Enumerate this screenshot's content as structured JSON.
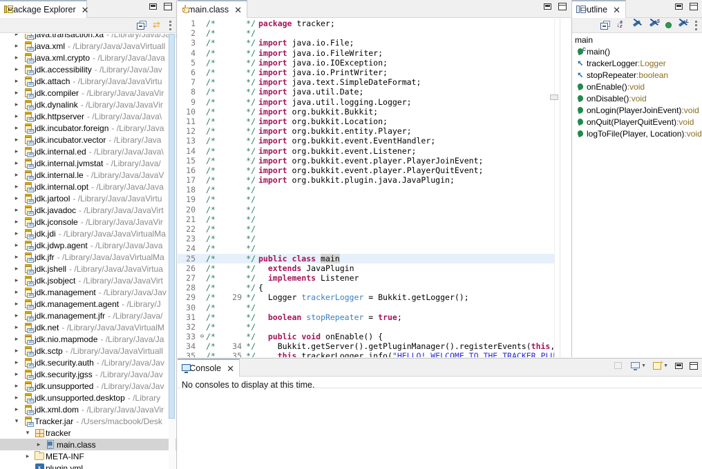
{
  "package_explorer": {
    "tab_label": "Package Explorer",
    "close_label": "✕",
    "toolbar": [
      "collapse-all-icon",
      "link-with-editor-icon",
      "view-menu-icon"
    ],
    "items": [
      {
        "name": "java.transaction.xa",
        "path": "- /Library/Java/JavaVi",
        "indent": 1,
        "arrow": "closed",
        "icon": "jar",
        "clipped": true
      },
      {
        "name": "java.xml",
        "path": "- /Library/Java/JavaVirtuall",
        "indent": 1,
        "arrow": "closed",
        "icon": "jar"
      },
      {
        "name": "java.xml.crypto",
        "path": "- /Library/Java/Java",
        "indent": 1,
        "arrow": "closed",
        "icon": "jar"
      },
      {
        "name": "jdk.accessibility",
        "path": "- /Library/Java/Jav",
        "indent": 1,
        "arrow": "closed",
        "icon": "jar"
      },
      {
        "name": "jdk.attach",
        "path": "- /Library/Java/JavaVirtu",
        "indent": 1,
        "arrow": "closed",
        "icon": "jar"
      },
      {
        "name": "jdk.compiler",
        "path": "- /Library/Java/JavaVir",
        "indent": 1,
        "arrow": "closed",
        "icon": "jar"
      },
      {
        "name": "jdk.dynalink",
        "path": "- /Library/Java/JavaVir",
        "indent": 1,
        "arrow": "closed",
        "icon": "jar"
      },
      {
        "name": "jdk.httpserver",
        "path": "- /Library/Java/Java\\",
        "indent": 1,
        "arrow": "closed",
        "icon": "jar"
      },
      {
        "name": "jdk.incubator.foreign",
        "path": "- /Library/Java",
        "indent": 1,
        "arrow": "closed",
        "icon": "jar"
      },
      {
        "name": "jdk.incubator.vector",
        "path": "- /Library/Java",
        "indent": 1,
        "arrow": "closed",
        "icon": "jar"
      },
      {
        "name": "jdk.internal.ed",
        "path": "- /Library/Java/Java\\",
        "indent": 1,
        "arrow": "closed",
        "icon": "jar"
      },
      {
        "name": "jdk.internal.jvmstat",
        "path": "- /Library/Java/",
        "indent": 1,
        "arrow": "closed",
        "icon": "jar"
      },
      {
        "name": "jdk.internal.le",
        "path": "- /Library/Java/JavaV",
        "indent": 1,
        "arrow": "closed",
        "icon": "jar"
      },
      {
        "name": "jdk.internal.opt",
        "path": "- /Library/Java/Java",
        "indent": 1,
        "arrow": "closed",
        "icon": "jar"
      },
      {
        "name": "jdk.jartool",
        "path": "- /Library/Java/JavaVirtu",
        "indent": 1,
        "arrow": "closed",
        "icon": "jar"
      },
      {
        "name": "jdk.javadoc",
        "path": "- /Library/Java/JavaVirt",
        "indent": 1,
        "arrow": "closed",
        "icon": "jar"
      },
      {
        "name": "jdk.jconsole",
        "path": "- /Library/Java/JavaVir",
        "indent": 1,
        "arrow": "closed",
        "icon": "jar"
      },
      {
        "name": "jdk.jdi",
        "path": "- /Library/Java/JavaVirtualMa",
        "indent": 1,
        "arrow": "closed",
        "icon": "jar"
      },
      {
        "name": "jdk.jdwp.agent",
        "path": "- /Library/Java/Java",
        "indent": 1,
        "arrow": "closed",
        "icon": "jar"
      },
      {
        "name": "jdk.jfr",
        "path": "- /Library/Java/JavaVirtualMa",
        "indent": 1,
        "arrow": "closed",
        "icon": "jar"
      },
      {
        "name": "jdk.jshell",
        "path": "- /Library/Java/JavaVirtua",
        "indent": 1,
        "arrow": "closed",
        "icon": "jar"
      },
      {
        "name": "jdk.jsobject",
        "path": "- /Library/Java/JavaVirt",
        "indent": 1,
        "arrow": "closed",
        "icon": "jar"
      },
      {
        "name": "jdk.management",
        "path": "- /Library/Java/Jav",
        "indent": 1,
        "arrow": "closed",
        "icon": "jar"
      },
      {
        "name": "jdk.management.agent",
        "path": "- /Library/J",
        "indent": 1,
        "arrow": "closed",
        "icon": "jar"
      },
      {
        "name": "jdk.management.jfr",
        "path": "- /Library/Java/",
        "indent": 1,
        "arrow": "closed",
        "icon": "jar"
      },
      {
        "name": "jdk.net",
        "path": "- /Library/Java/JavaVirtualM",
        "indent": 1,
        "arrow": "closed",
        "icon": "jar"
      },
      {
        "name": "jdk.nio.mapmode",
        "path": "- /Library/Java/Ja",
        "indent": 1,
        "arrow": "closed",
        "icon": "jar"
      },
      {
        "name": "jdk.sctp",
        "path": "- /Library/Java/JavaVirtuall",
        "indent": 1,
        "arrow": "closed",
        "icon": "jar"
      },
      {
        "name": "jdk.security.auth",
        "path": "- /Library/Java/Jav",
        "indent": 1,
        "arrow": "closed",
        "icon": "jar"
      },
      {
        "name": "jdk.security.jgss",
        "path": "- /Library/Java/Jav",
        "indent": 1,
        "arrow": "closed",
        "icon": "jar"
      },
      {
        "name": "jdk.unsupported",
        "path": "- /Library/Java/Jav",
        "indent": 1,
        "arrow": "closed",
        "icon": "jar"
      },
      {
        "name": "jdk.unsupported.desktop",
        "path": "- /Library",
        "indent": 1,
        "arrow": "closed",
        "icon": "jar"
      },
      {
        "name": "jdk.xml.dom",
        "path": "- /Library/Java/JavaVir",
        "indent": 1,
        "arrow": "closed",
        "icon": "jar"
      },
      {
        "name": "Tracker.jar",
        "path": "- /Users/macbook/Desk",
        "indent": 1,
        "arrow": "open",
        "icon": "jar"
      },
      {
        "name": "tracker",
        "path": "",
        "indent": 2,
        "arrow": "open",
        "icon": "pkg"
      },
      {
        "name": "main.class",
        "path": "",
        "indent": 3,
        "arrow": "closed",
        "icon": "class",
        "selected": true
      },
      {
        "name": "META-INF",
        "path": "",
        "indent": 2,
        "arrow": "closed",
        "icon": "folder"
      },
      {
        "name": "plugin.yml",
        "path": "",
        "indent": 2,
        "arrow": "none",
        "icon": "xml"
      }
    ]
  },
  "editor": {
    "tab_label": "main.class",
    "close_label": "✕",
    "minimize_label": "minimize-icon",
    "maximize_label": "maximize-icon",
    "lines": [
      {
        "no": "1",
        "bc": "",
        "code": "package tracker;",
        "tokens": [
          {
            "t": "package",
            "c": "kw"
          },
          {
            "t": " tracker;",
            "c": "src"
          }
        ]
      },
      {
        "no": "2",
        "bc": "",
        "tokens": []
      },
      {
        "no": "3",
        "bc": "",
        "tokens": [
          {
            "t": "import",
            "c": "kw"
          },
          {
            "t": " java.io.File;",
            "c": "src"
          }
        ]
      },
      {
        "no": "4",
        "bc": "",
        "tokens": [
          {
            "t": "import",
            "c": "kw"
          },
          {
            "t": " java.io.FileWriter;",
            "c": "src"
          }
        ]
      },
      {
        "no": "5",
        "bc": "",
        "tokens": [
          {
            "t": "import",
            "c": "kw"
          },
          {
            "t": " java.io.IOException;",
            "c": "src"
          }
        ]
      },
      {
        "no": "6",
        "bc": "",
        "tokens": [
          {
            "t": "import",
            "c": "kw"
          },
          {
            "t": " java.io.PrintWriter;",
            "c": "src"
          }
        ]
      },
      {
        "no": "7",
        "bc": "",
        "tokens": [
          {
            "t": "import",
            "c": "kw"
          },
          {
            "t": " java.text.SimpleDateFormat;",
            "c": "src"
          }
        ]
      },
      {
        "no": "8",
        "bc": "",
        "tokens": [
          {
            "t": "import",
            "c": "kw"
          },
          {
            "t": " java.util.Date;",
            "c": "src"
          }
        ]
      },
      {
        "no": "9",
        "bc": "",
        "tokens": [
          {
            "t": "import",
            "c": "kw"
          },
          {
            "t": " java.util.logging.Logger;",
            "c": "src"
          }
        ]
      },
      {
        "no": "10",
        "bc": "",
        "tokens": [
          {
            "t": "import",
            "c": "kw"
          },
          {
            "t": " org.bukkit.Bukkit;",
            "c": "src"
          }
        ]
      },
      {
        "no": "11",
        "bc": "",
        "tokens": [
          {
            "t": "import",
            "c": "kw"
          },
          {
            "t": " org.bukkit.Location;",
            "c": "src"
          }
        ]
      },
      {
        "no": "12",
        "bc": "",
        "tokens": [
          {
            "t": "import",
            "c": "kw"
          },
          {
            "t": " org.bukkit.entity.Player;",
            "c": "src"
          }
        ]
      },
      {
        "no": "13",
        "bc": "",
        "tokens": [
          {
            "t": "import",
            "c": "kw"
          },
          {
            "t": " org.bukkit.event.EventHandler;",
            "c": "src"
          }
        ]
      },
      {
        "no": "14",
        "bc": "",
        "tokens": [
          {
            "t": "import",
            "c": "kw"
          },
          {
            "t": " org.bukkit.event.Listener;",
            "c": "src"
          }
        ]
      },
      {
        "no": "15",
        "bc": "",
        "tokens": [
          {
            "t": "import",
            "c": "kw"
          },
          {
            "t": " org.bukkit.event.player.PlayerJoinEvent;",
            "c": "src"
          }
        ]
      },
      {
        "no": "16",
        "bc": "",
        "tokens": [
          {
            "t": "import",
            "c": "kw"
          },
          {
            "t": " org.bukkit.event.player.PlayerQuitEvent;",
            "c": "src"
          }
        ]
      },
      {
        "no": "17",
        "bc": "",
        "tokens": [
          {
            "t": "import",
            "c": "kw"
          },
          {
            "t": " org.bukkit.plugin.java.JavaPlugin;",
            "c": "src"
          }
        ]
      },
      {
        "no": "18",
        "bc": "",
        "tokens": []
      },
      {
        "no": "19",
        "bc": "",
        "tokens": []
      },
      {
        "no": "20",
        "bc": "",
        "tokens": []
      },
      {
        "no": "21",
        "bc": "",
        "tokens": []
      },
      {
        "no": "22",
        "bc": "",
        "tokens": []
      },
      {
        "no": "23",
        "bc": "",
        "tokens": []
      },
      {
        "no": "24",
        "bc": "",
        "tokens": []
      },
      {
        "no": "25",
        "bc": "",
        "current": true,
        "tokens": [
          {
            "t": "public class ",
            "c": "kw"
          },
          {
            "t": "main",
            "c": "occ"
          }
        ]
      },
      {
        "no": "26",
        "bc": "",
        "tokens": [
          {
            "t": "  ",
            "c": "src"
          },
          {
            "t": "extends",
            "c": "kw"
          },
          {
            "t": " JavaPlugin",
            "c": "src"
          }
        ]
      },
      {
        "no": "27",
        "bc": "",
        "tokens": [
          {
            "t": "  ",
            "c": "src"
          },
          {
            "t": "implements",
            "c": "kw"
          },
          {
            "t": " Listener",
            "c": "src"
          }
        ]
      },
      {
        "no": "28",
        "bc": "",
        "tokens": [
          {
            "t": "{",
            "c": "src"
          }
        ]
      },
      {
        "no": "29",
        "bc": "29",
        "tokens": [
          {
            "t": "  Logger ",
            "c": "src"
          },
          {
            "t": "trackerLogger",
            "c": "fld"
          },
          {
            "t": " = Bukkit.getLogger();",
            "c": "src"
          }
        ]
      },
      {
        "no": "30",
        "bc": "",
        "tokens": []
      },
      {
        "no": "31",
        "bc": "",
        "tokens": [
          {
            "t": "  ",
            "c": "src"
          },
          {
            "t": "boolean",
            "c": "kw"
          },
          {
            "t": " ",
            "c": "src"
          },
          {
            "t": "stopRepeater",
            "c": "fld"
          },
          {
            "t": " = ",
            "c": "src"
          },
          {
            "t": "true",
            "c": "kw"
          },
          {
            "t": ";",
            "c": "src"
          }
        ]
      },
      {
        "no": "32",
        "bc": "",
        "tokens": []
      },
      {
        "no": "33",
        "bc": "",
        "fold": true,
        "tokens": [
          {
            "t": "  ",
            "c": "src"
          },
          {
            "t": "public void",
            "c": "kw"
          },
          {
            "t": " onEnable() {",
            "c": "src"
          }
        ]
      },
      {
        "no": "34",
        "bc": "34",
        "tokens": [
          {
            "t": "    Bukkit.getServer().getPluginManager().registerEvents(",
            "c": "src"
          },
          {
            "t": "this",
            "c": "kw"
          },
          {
            "t": ",",
            "c": "src"
          }
        ]
      },
      {
        "no": "35",
        "bc": "35",
        "clipped": true,
        "tokens": [
          {
            "t": "    ",
            "c": "src"
          },
          {
            "t": "this",
            "c": "kw"
          },
          {
            "t": ".trackerLogger.info(",
            "c": "src"
          },
          {
            "t": "\"HELLO! WELCOME TO THE TRACKER PLU",
            "c": "str"
          }
        ]
      }
    ],
    "comment_open": "/*",
    "comment_close": "*/"
  },
  "outline": {
    "tab_label": "Outline",
    "close_label": "✕",
    "toolbar": [
      "collapse-all-icon",
      "sort-icon",
      "hide-fields-icon",
      "hide-static-icon",
      "hide-nonpublic-icon",
      "hide-local-icon",
      "view-menu-icon"
    ],
    "root": "main",
    "items": [
      {
        "label": "main()",
        "type": "",
        "icon": "class-member",
        "sup": "C"
      },
      {
        "label": "trackerLogger",
        "type": "Logger",
        "icon": "field"
      },
      {
        "label": "stopRepeater",
        "type": "boolean",
        "icon": "field"
      },
      {
        "label": "onEnable()",
        "type": "void",
        "icon": "method"
      },
      {
        "label": "onDisable()",
        "type": "void",
        "icon": "method"
      },
      {
        "label": "onLogin(PlayerJoinEvent)",
        "type": "void",
        "icon": "method"
      },
      {
        "label": "onQuit(PlayerQuitEvent)",
        "type": "void",
        "icon": "method"
      },
      {
        "label": "logToFile(Player, Location)",
        "type": "void",
        "icon": "method"
      }
    ],
    "type_separator": " : "
  },
  "console": {
    "tab_label": "Console",
    "close_label": "✕",
    "message": "No consoles to display at this time.",
    "toolbar": [
      "clear-console-icon",
      "display-selected-console-icon",
      "open-console-icon",
      "minimize-icon",
      "maximize-icon"
    ]
  },
  "colors": {
    "keyword": "#a4145a",
    "comment": "#2e7d5b",
    "field": "#3a7fc1",
    "string": "#2a2ad6",
    "current_line": "#e6f0fb",
    "selection": "#d4d4d4"
  }
}
